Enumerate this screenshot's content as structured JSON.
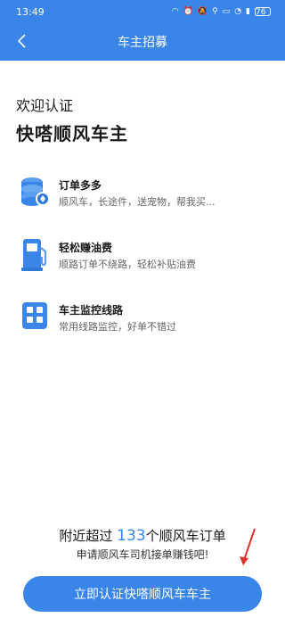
{
  "status": {
    "time": "13:49",
    "battery": "76"
  },
  "header": {
    "title": "车主招募"
  },
  "intro": {
    "welcome": "欢迎认证",
    "brand": "快嗒顺风车主"
  },
  "features": [
    {
      "title": "订单多多",
      "desc": "顺风车，长途件，送宠物，帮我买...",
      "icon": "coins-stack-icon"
    },
    {
      "title": "轻松赚油费",
      "desc": "顺路订单不绕路，轻松补贴油费",
      "icon": "fuel-pump-icon"
    },
    {
      "title": "车主监控线路",
      "desc": "常用线路监控，好单不错过",
      "icon": "grid-building-icon"
    }
  ],
  "promo": {
    "prefix": "附近超过 ",
    "count": "133",
    "suffix": "个顺风车订单",
    "subtitle": "申请顺风车司机接单赚钱吧!"
  },
  "cta": {
    "label": "立即认证快嗒顺风车车主"
  },
  "colors": {
    "accent": "#3a86e8",
    "arrow": "#d9342b"
  }
}
